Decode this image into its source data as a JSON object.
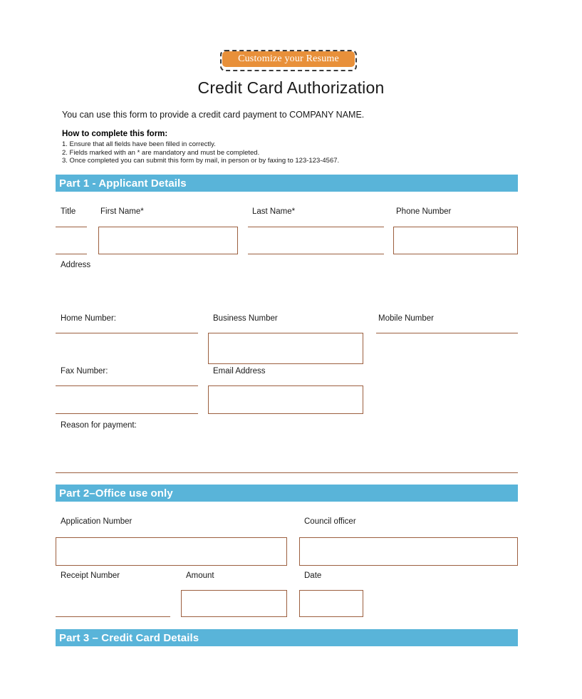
{
  "badge": {
    "label": "Customize your Resume"
  },
  "document": {
    "title": "Credit Card Authorization",
    "intro": "You can use this form to provide a credit card payment to COMPANY NAME.",
    "howto_heading": "How to complete this form:",
    "howto_steps": [
      "1. Ensure that all fields have been filled in correctly.",
      "2. Fields marked with an * are mandatory and must be completed.",
      "3. Once completed you can submit this form by mail, in person or by faxing to 123-123-4567."
    ]
  },
  "colors": {
    "section_bar": "#59b4d9",
    "badge_orange": "#e8903a",
    "field_border": "#9c5f3f"
  },
  "part1": {
    "heading": "Part 1 - Applicant Details",
    "fields": {
      "title": "Title",
      "first_name": "First Name*",
      "last_name": "Last Name*",
      "phone_number": "Phone Number",
      "address": "Address",
      "home_number": "Home Number:",
      "business_number": "Business Number",
      "mobile_number": "Mobile Number",
      "fax_number": "Fax Number:",
      "email_address": "Email Address",
      "reason_for_payment": "Reason for payment:"
    }
  },
  "part2": {
    "heading": "Part 2–Office use only",
    "fields": {
      "application_number": "Application Number",
      "council_officer": "Council officer",
      "receipt_number": "Receipt Number",
      "amount": "Amount",
      "date": "Date"
    }
  },
  "part3": {
    "heading": "Part 3 – Credit Card Details"
  }
}
